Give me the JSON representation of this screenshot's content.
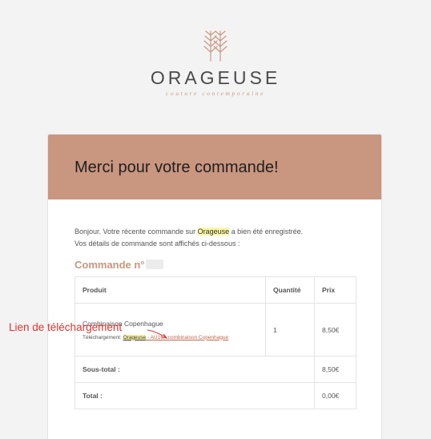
{
  "brand": {
    "name": "ORAGEUSE",
    "tagline": "couture contemporaine"
  },
  "header": {
    "title": "Merci pour votre commande!"
  },
  "intro": {
    "part1": "Bonjour. Votre récente commande sur ",
    "shop": "Orageuse",
    "part2": " a bien été enregistrée.",
    "line2": "Vos détails de commande sont affichés ci-dessous :"
  },
  "order": {
    "title_prefix": "Commande n°"
  },
  "table": {
    "headers": {
      "product": "Produit",
      "quantity": "Quantité",
      "price": "Prix"
    },
    "item": {
      "name": "Combinaison Copenhague",
      "quantity": "1",
      "price": "8,50€",
      "download_label": "Téléchargement: ",
      "download_shop": "Orageuse",
      "download_rest": " - AU16 - combinaison Copenhague"
    },
    "subtotal": {
      "label": "Sous-total :",
      "value": "8,50€"
    },
    "total": {
      "label": "Total :",
      "value": "0,00€"
    }
  },
  "annotation": {
    "text": "Lien de téléchargement"
  },
  "colors": {
    "accent": "#c99680",
    "annotation": "#e0342f",
    "highlight": "#fbf7a4"
  }
}
